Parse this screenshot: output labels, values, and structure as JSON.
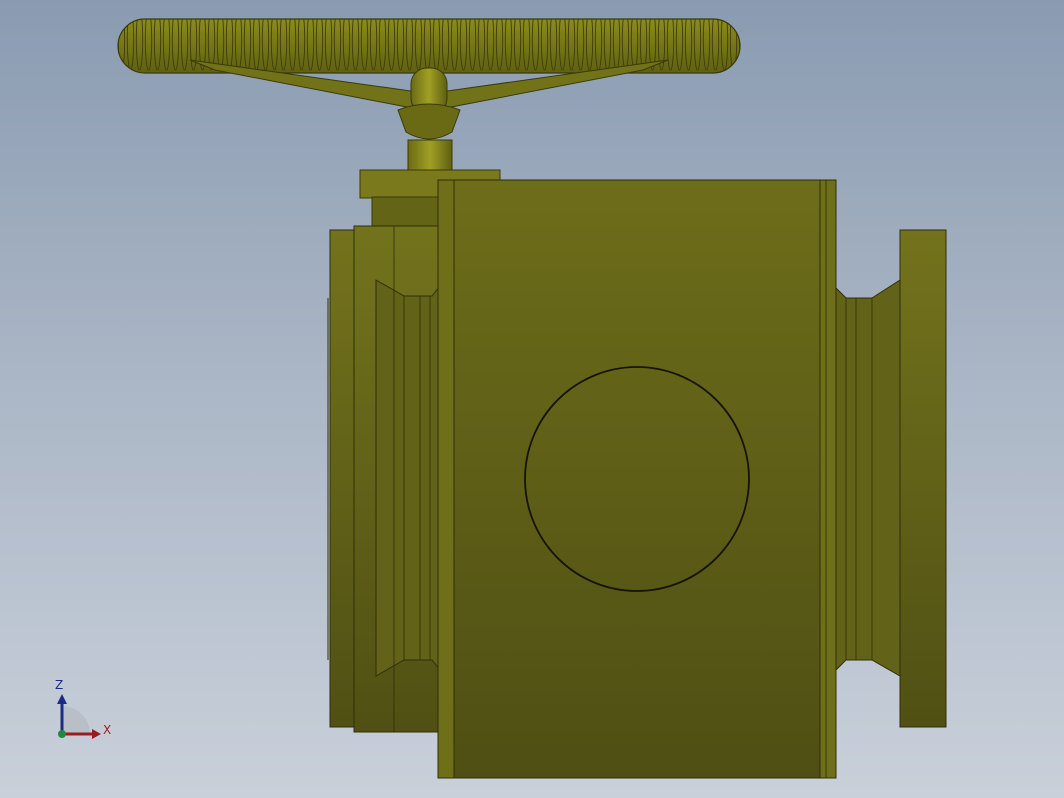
{
  "viewport": {
    "model_name": "gate-valve-with-handwheel",
    "model_color": "#6b6b1c",
    "background_top": "#8a9bb1",
    "background_bottom": "#c9d0da"
  },
  "triad": {
    "z_label": "Z",
    "x_label": "X",
    "z_color": "#1c2a8a",
    "x_color": "#9b1c1c"
  }
}
